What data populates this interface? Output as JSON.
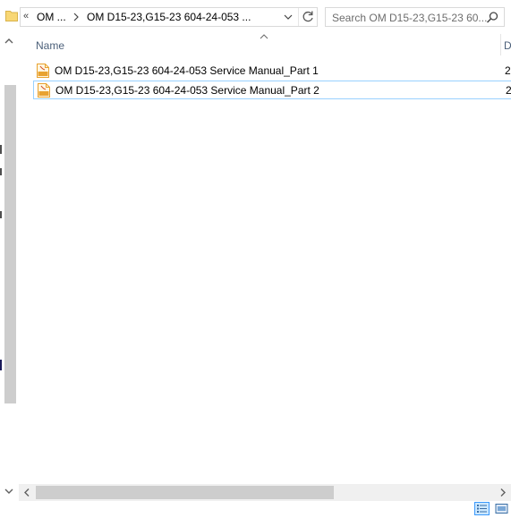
{
  "address_bar": {
    "crumb_overflow": "«",
    "crumb_1": "OM ...",
    "crumb_2": "OM D15-23,G15-23 604-24-053 ..."
  },
  "search": {
    "placeholder": "Search OM D15-23,G15-23 60..."
  },
  "columns": {
    "name": "Name",
    "date_truncated": "D"
  },
  "files": [
    {
      "name": "OM D15-23,G15-23 604-24-053 Service Manual_Part 1",
      "date_truncated": "2",
      "icon": "pdf-icon",
      "selected": false
    },
    {
      "name": "OM D15-23,G15-23 604-24-053 Service Manual_Part 2",
      "date_truncated": "2",
      "icon": "pdf-icon",
      "selected": true
    }
  ],
  "colors": {
    "selection_border": "#99d1ff",
    "header_text": "#4c607a",
    "folder_yellow": "#f8d775",
    "pdf_orange": "#e8a230"
  }
}
